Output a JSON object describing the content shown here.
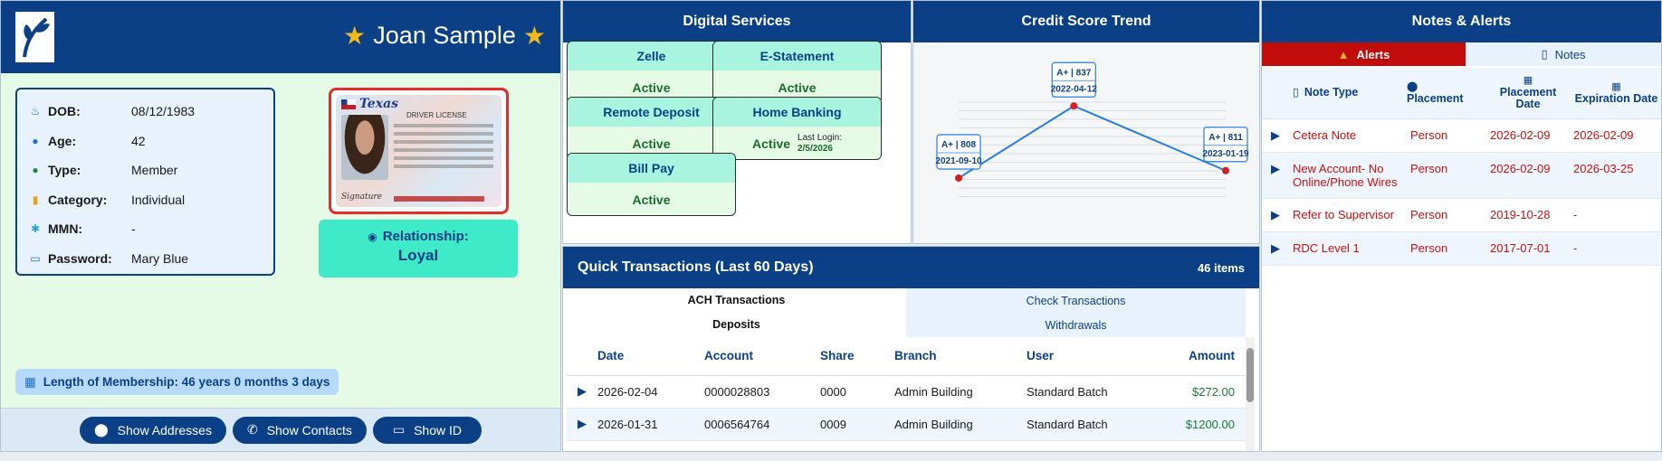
{
  "member": {
    "name": "Joan Sample",
    "info": [
      {
        "icon": "calendar-cake-icon",
        "glyph": "♨",
        "label": "DOB:",
        "value": "08/12/1983"
      },
      {
        "icon": "clock-icon",
        "glyph": "●",
        "label": "Age:",
        "value": "42"
      },
      {
        "icon": "person-icon",
        "glyph": "●",
        "label": "Type:",
        "value": "Member"
      },
      {
        "icon": "category-icon",
        "glyph": "▮",
        "label": "Category:",
        "value": "Individual"
      },
      {
        "icon": "family-icon",
        "glyph": "✱",
        "label": "MMN:",
        "value": "-"
      },
      {
        "icon": "id-card-icon",
        "glyph": "▭",
        "label": "Password:",
        "value": "Mary Blue"
      }
    ],
    "id_card": {
      "state": "Texas",
      "doc": "DRIVER LICENSE",
      "signature": "Signature"
    },
    "relationship_label": "Relationship:",
    "relationship_value": "Loyal",
    "membership": "Length of Membership: 46 years 0 months 3 days",
    "buttons": {
      "addresses": "Show Addresses",
      "contacts": "Show Contacts",
      "id": "Show ID"
    }
  },
  "digital": {
    "title": "Digital Services",
    "services": [
      {
        "name": "Zelle",
        "status": "Active"
      },
      {
        "name": "E-Statement",
        "status": "Active"
      },
      {
        "name": "Remote Deposit",
        "status": "Active"
      },
      {
        "name": "Home Banking",
        "status": "Active",
        "last_login_label": "Last Login:",
        "last_login": "2/5/2026"
      },
      {
        "name": "Bill Pay",
        "status": "Active"
      }
    ]
  },
  "credit": {
    "title": "Credit Score Trend",
    "chart_data": {
      "type": "line",
      "points": [
        {
          "date": "2021-09-10",
          "score": 808,
          "grade": "A+"
        },
        {
          "date": "2022-04-12",
          "score": 837,
          "grade": "A+"
        },
        {
          "date": "2023-01-19",
          "score": 811,
          "grade": "A+"
        }
      ],
      "line_color": "#2a7be4",
      "marker_color": "#d42020",
      "grid": true
    }
  },
  "quick": {
    "title": "Quick Transactions (Last 60 Days)",
    "count": "46 items",
    "tabs": [
      "ACH Transactions",
      "Check Transactions"
    ],
    "subtabs": [
      "Deposits",
      "Withdrawals"
    ],
    "columns": [
      "Date",
      "Account",
      "Share",
      "Branch",
      "User",
      "Amount"
    ],
    "rows": [
      {
        "date": "2026-02-04",
        "account": "0000028803",
        "share": "0000",
        "branch": "Admin Building",
        "user": "Standard Batch",
        "amount": "$272.00"
      },
      {
        "date": "2026-01-31",
        "account": "0006564764",
        "share": "0009",
        "branch": "Admin Building",
        "user": "Standard Batch",
        "amount": "$1200.00"
      }
    ]
  },
  "notes": {
    "title": "Notes & Alerts",
    "tab_alerts": "Alerts",
    "tab_notes": "Notes",
    "columns": [
      "Note Type",
      "Placement",
      "Placement Date",
      "Expiration Date"
    ],
    "rows": [
      {
        "type": "Cetera Note",
        "placement": "Person",
        "date": "2026-02-09",
        "exp": "2026-02-09"
      },
      {
        "type": "New Account- No Online/Phone Wires",
        "placement": "Person",
        "date": "2026-02-09",
        "exp": "2026-03-25"
      },
      {
        "type": "Refer to Supervisor",
        "placement": "Person",
        "date": "2019-10-28",
        "exp": "-"
      },
      {
        "type": "RDC Level 1",
        "placement": "Person",
        "date": "2017-07-01",
        "exp": "-"
      }
    ]
  }
}
